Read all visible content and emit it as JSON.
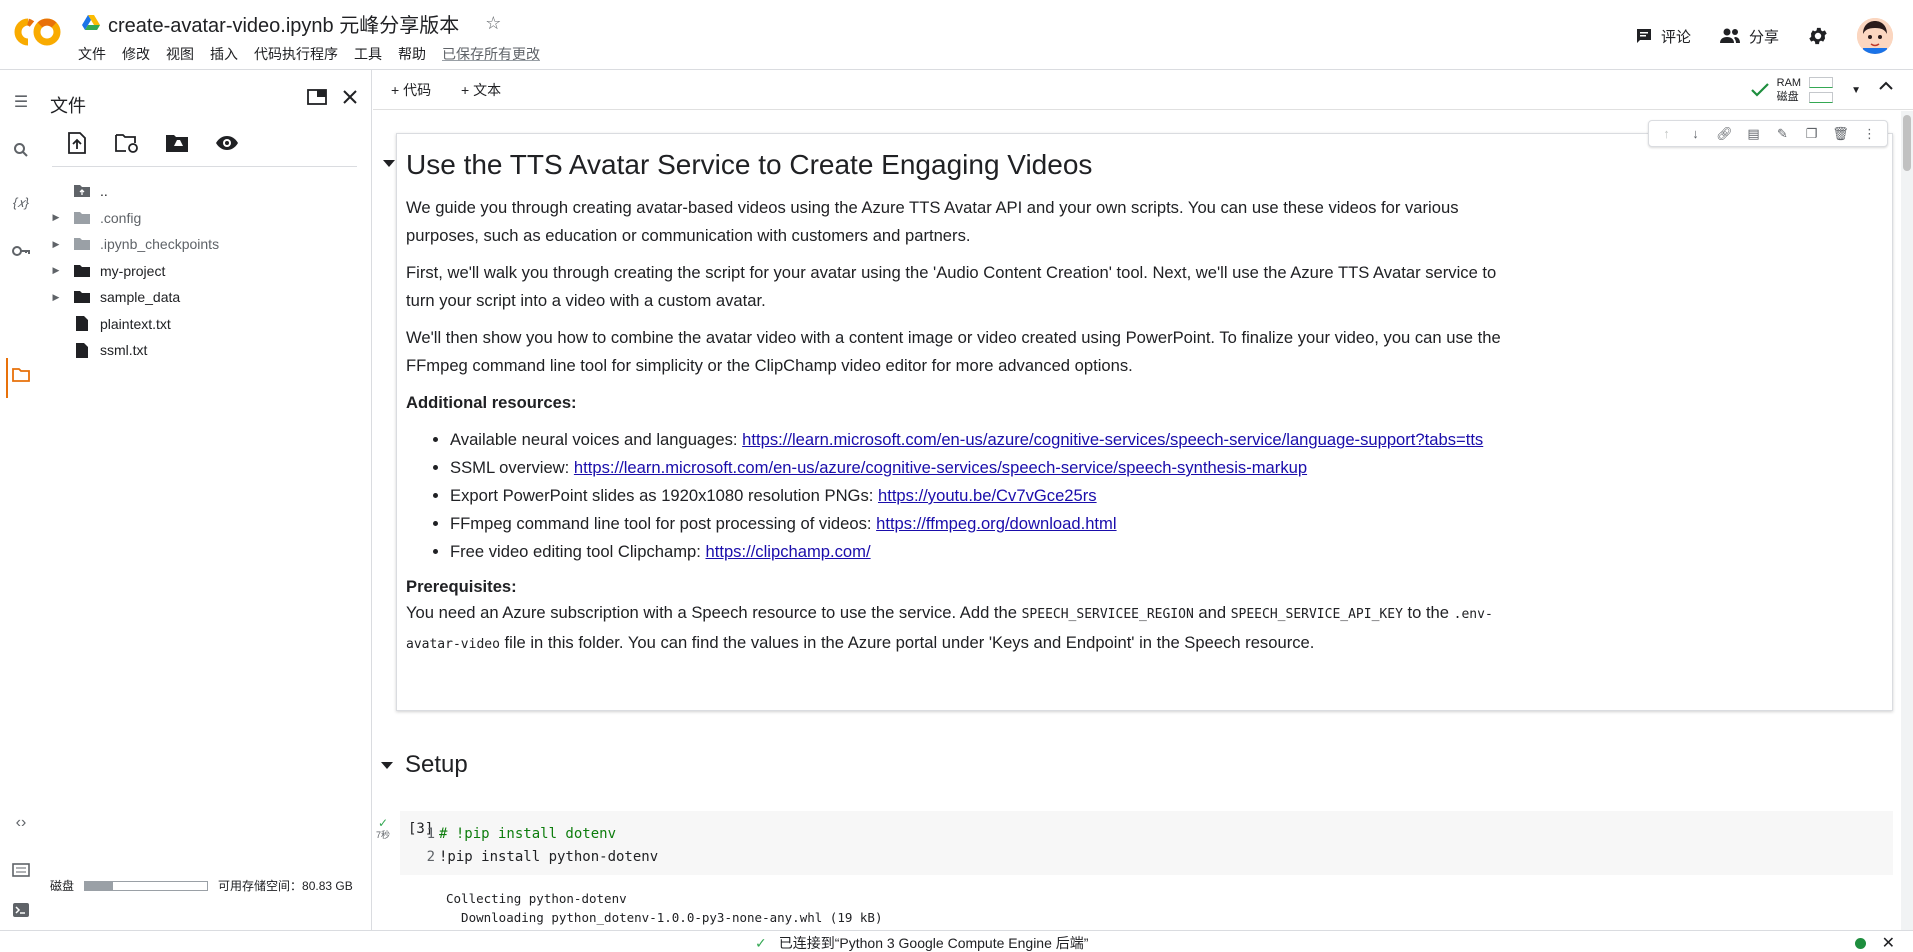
{
  "header": {
    "notebook_title": "create-avatar-video.ipynb 元峰分享版本",
    "menu": [
      "文件",
      "修改",
      "视图",
      "插入",
      "代码执行程序",
      "工具",
      "帮助"
    ],
    "saved_status": "已保存所有更改",
    "comment_label": "评论",
    "share_label": "分享"
  },
  "files_panel": {
    "title": "文件",
    "tree": [
      {
        "name": "..",
        "type": "parent"
      },
      {
        "name": ".config",
        "type": "folder"
      },
      {
        "name": ".ipynb_checkpoints",
        "type": "folder"
      },
      {
        "name": "my-project",
        "type": "folder"
      },
      {
        "name": "sample_data",
        "type": "folder"
      },
      {
        "name": "plaintext.txt",
        "type": "file"
      },
      {
        "name": "ssml.txt",
        "type": "file"
      }
    ],
    "disk_label": "磁盘",
    "disk_available": "可用存储空间：80.83 GB"
  },
  "toolbar": {
    "add_code": "+ 代码",
    "add_text": "+ 文本",
    "ram_label": "RAM",
    "disk_label": "磁盘"
  },
  "markdown_cell": {
    "heading": "Use the TTS Avatar Service to Create Engaging Videos",
    "p1": "We guide you through creating avatar-based videos using the Azure TTS Avatar API and your own scripts. You can use these videos for various purposes, such as education or communication with customers and partners.",
    "p2": "First, we'll walk you through creating the script for your avatar using the 'Audio Content Creation' tool. Next, we'll use the Azure TTS Avatar service to turn your script into a video with a custom avatar.",
    "p3": "We'll then show you how to combine the avatar video with a content image or video created using PowerPoint. To finalize your video, you can use the FFmpeg command line tool for simplicity or the ClipChamp video editor for more advanced options.",
    "resources_heading": "Additional resources:",
    "resources": [
      {
        "text": "Available neural voices and languages: ",
        "link": "https://learn.microsoft.com/en-us/azure/cognitive-services/speech-service/language-support?tabs=tts"
      },
      {
        "text": "SSML overview: ",
        "link": "https://learn.microsoft.com/en-us/azure/cognitive-services/speech-service/speech-synthesis-markup"
      },
      {
        "text": "Export PowerPoint slides as 1920x1080 resolution PNGs: ",
        "link": "https://youtu.be/Cv7vGce25rs"
      },
      {
        "text": "FFmpeg command line tool for post processing of videos: ",
        "link": "https://ffmpeg.org/download.html"
      },
      {
        "text": "Free video editing tool Clipchamp: ",
        "link": "https://clipchamp.com/"
      }
    ],
    "prereq_heading": "Prerequisites:",
    "prereq_1": "You need an Azure subscription with a Speech resource to use the service. Add the ",
    "prereq_code1": "SPEECH_SERVICEE_REGION",
    "prereq_2": " and ",
    "prereq_code2": "SPEECH_SERVICE_API_KEY",
    "prereq_3": " to the ",
    "prereq_code3": ".env-avatar-video",
    "prereq_4": " file in this folder. You can find the values in the Azure portal under 'Keys and Endpoint' in the Speech resource."
  },
  "setup_heading": "Setup",
  "code_cell": {
    "exec_count": "[3]",
    "duration": "7秒",
    "line1_num": "1",
    "line1": "#  !pip  install  dotenv",
    "line2_num": "2",
    "line2": "!pip  install  python-dotenv",
    "output": [
      "Collecting python-dotenv",
      "  Downloading python_dotenv-1.0.0-py3-none-any.whl (19 kB)"
    ]
  },
  "status_bar": {
    "message": "已连接到“Python 3 Google Compute Engine 后端”"
  }
}
